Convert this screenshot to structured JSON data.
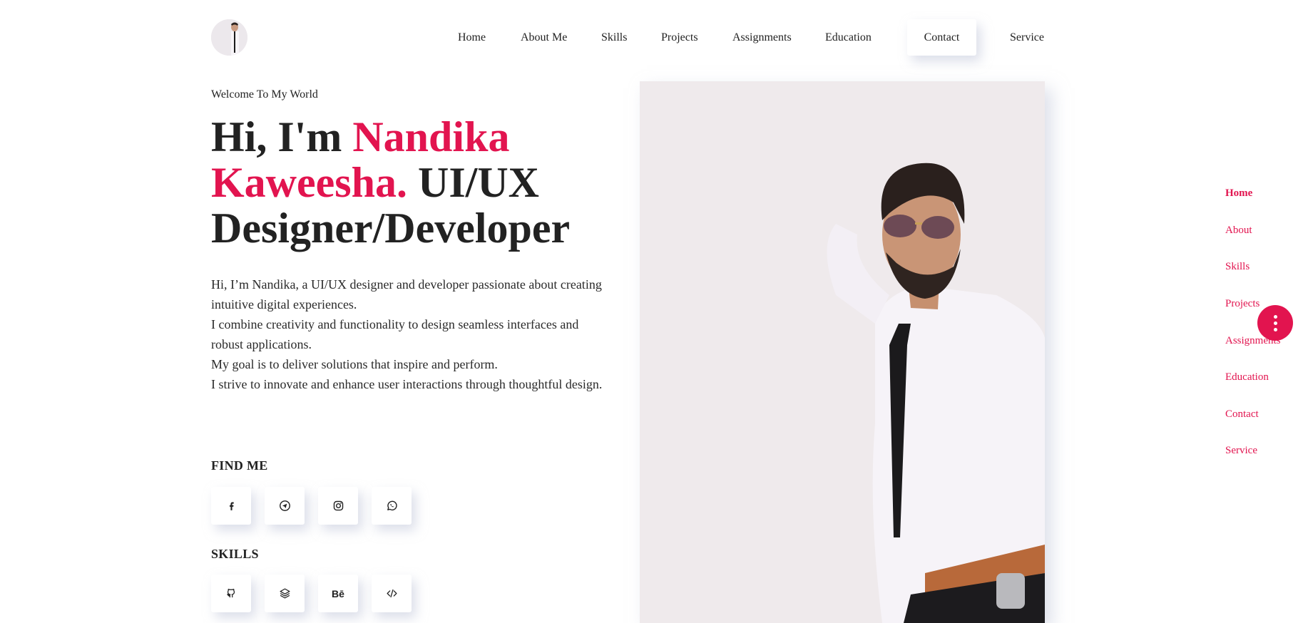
{
  "nav": {
    "items": [
      {
        "label": "Home"
      },
      {
        "label": "About Me"
      },
      {
        "label": "Skills"
      },
      {
        "label": "Projects"
      },
      {
        "label": "Assignments"
      },
      {
        "label": "Education"
      },
      {
        "label": "Contact"
      },
      {
        "label": "Service"
      }
    ],
    "active_label": "Contact"
  },
  "hero": {
    "welcome": "Welcome To My World",
    "headline_prefix": "Hi, I'm ",
    "headline_name": "Nandika Kaweesha.",
    "headline_suffix": " UI/UX Designer/Developer",
    "bio": [
      "Hi, I’m Nandika, a UI/UX designer and developer passionate about creating intuitive digital experiences.",
      "I combine creativity and functionality to design seamless interfaces and robust applications.",
      "My goal is to deliver solutions that inspire and perform.",
      "I strive to innovate and enhance user interactions through thoughtful design."
    ]
  },
  "find_me": {
    "title": "FIND ME",
    "icons": [
      "facebook-icon",
      "telegram-icon",
      "instagram-icon",
      "whatsapp-icon"
    ]
  },
  "skills": {
    "title": "SKILLS",
    "icons": [
      "github-icon",
      "layers-icon",
      "behance-icon",
      "code-icon"
    ],
    "behance_text": "Bē"
  },
  "side_nav": {
    "items": [
      {
        "label": "Home"
      },
      {
        "label": "About"
      },
      {
        "label": "Skills"
      },
      {
        "label": "Projects"
      },
      {
        "label": "Assignments"
      },
      {
        "label": "Education"
      },
      {
        "label": "Contact"
      },
      {
        "label": "Service"
      }
    ],
    "active_label": "Home"
  },
  "colors": {
    "accent": "#e2144f",
    "text": "#222222",
    "background": "#ffffff"
  }
}
